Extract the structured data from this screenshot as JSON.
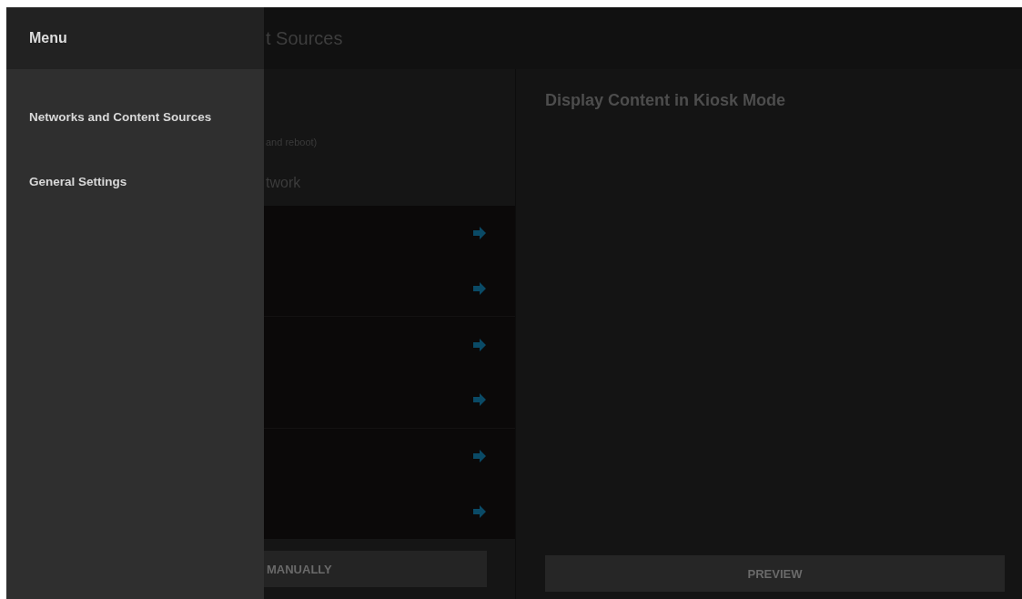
{
  "app_bar": {
    "title": "t Sources"
  },
  "left_panel": {
    "note": "and reboot)",
    "section_label": "twork",
    "rows": [
      {
        "kind": "arrow"
      },
      {
        "kind": "arrow"
      },
      {
        "kind": "arrow"
      },
      {
        "kind": "arrow"
      },
      {
        "kind": "arrow"
      },
      {
        "kind": "arrow"
      }
    ],
    "button": "MANUALLY"
  },
  "right_panel": {
    "heading": "Display Content in Kiosk Mode",
    "button": "PREVIEW"
  },
  "drawer": {
    "title": "Menu",
    "items": [
      {
        "label": "Networks and Content Sources"
      },
      {
        "label": "General Settings"
      }
    ]
  }
}
